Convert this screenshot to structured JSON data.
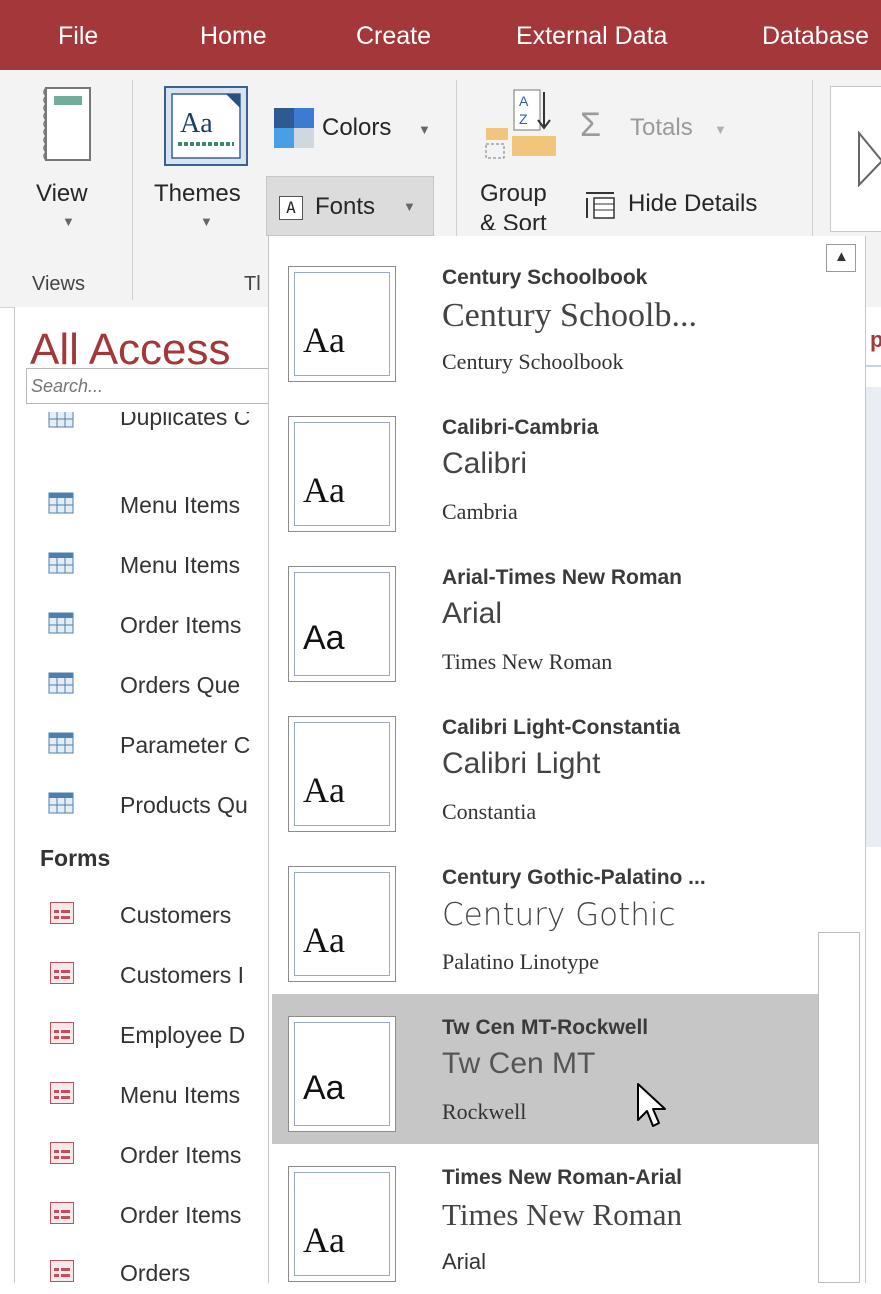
{
  "menu_tabs": [
    "File",
    "Home",
    "Create",
    "External Data",
    "Database"
  ],
  "ribbon": {
    "view_label": "View",
    "themes_label": "Themes",
    "colors_label": "Colors",
    "fonts_label": "Fonts",
    "group_sort_line1": "Group",
    "group_sort_line2": "& Sort",
    "totals_label": "Totals",
    "hide_details_label": "Hide Details",
    "views_group_label": "Views",
    "themes_group_label_partial": "Tl"
  },
  "nav": {
    "title": "All Access",
    "search_placeholder": "Search...",
    "query_items": [
      "Duplicates C",
      "Menu Items",
      "Menu Items",
      "Order Items",
      "Orders Que",
      "Parameter C",
      "Products Qu"
    ],
    "forms_section": "Forms",
    "form_items": [
      "Customers",
      "Customers I",
      "Employee D",
      "Menu Items",
      "Order Items",
      "Order Items",
      "Orders"
    ]
  },
  "doc_edge_text": "p",
  "fonts_dropdown": {
    "preview_glyph": "Aa",
    "items": [
      {
        "name": "Century Schoolbook",
        "heading": "Century Schoolb...",
        "body": "Century Schoolbook"
      },
      {
        "name": "Calibri-Cambria",
        "heading": "Calibri",
        "body": "Cambria"
      },
      {
        "name": "Arial-Times New Roman",
        "heading": "Arial",
        "body": "Times New Roman"
      },
      {
        "name": "Calibri Light-Constantia",
        "heading": "Calibri Light",
        "body": "Constantia"
      },
      {
        "name": "Century Gothic-Palatino ...",
        "heading": "Century Gothic",
        "body": "Palatino Linotype"
      },
      {
        "name": "Tw Cen MT-Rockwell",
        "heading": "Tw Cen MT",
        "body": "Rockwell",
        "hovered": true
      },
      {
        "name": "Times New Roman-Arial",
        "heading": "Times New Roman",
        "body": "Arial"
      }
    ]
  },
  "colors": {
    "accent": "#a4373a",
    "hover": "#c6c6c6",
    "ribbon_bg": "#f3f3f3"
  }
}
